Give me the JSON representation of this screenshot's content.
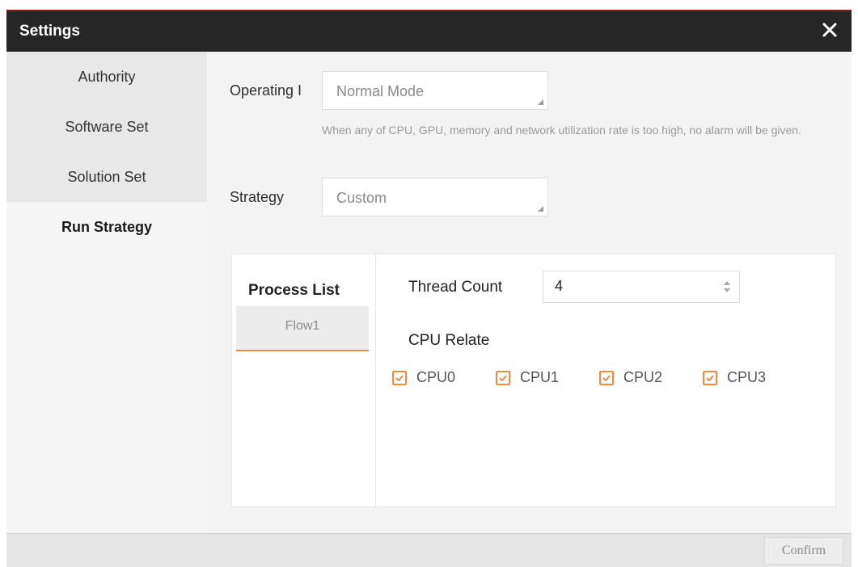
{
  "window": {
    "title": "Settings"
  },
  "sidebar": {
    "items": [
      {
        "label": "Authority"
      },
      {
        "label": "Software Set"
      },
      {
        "label": "Solution Set"
      },
      {
        "label": "Run Strategy"
      }
    ],
    "active": "Run Strategy"
  },
  "form": {
    "operating_label": "Operating I",
    "operating_value": "Normal Mode",
    "hint": "When any of CPU, GPU, memory and network utilization rate is too high, no alarm will be given.",
    "strategy_label": "Strategy",
    "strategy_value": "Custom"
  },
  "process_panel": {
    "title": "Process List",
    "items": [
      {
        "label": "Flow1"
      }
    ],
    "thread_count_label": "Thread Count",
    "thread_count_value": "4",
    "cpu_relate_label": "CPU Relate",
    "cpus": [
      {
        "label": "CPU0",
        "checked": true
      },
      {
        "label": "CPU1",
        "checked": true
      },
      {
        "label": "CPU2",
        "checked": true
      },
      {
        "label": "CPU3",
        "checked": true
      }
    ]
  },
  "footer": {
    "confirm_label": "Confirm"
  },
  "colors": {
    "accent": "#f08a3c",
    "titlebar": "#262626",
    "topline": "#8c1c1c"
  },
  "icons": {
    "close": "close-icon",
    "check": "checkmark-icon",
    "spin": "spin-arrows-icon",
    "grip": "resize-grip-icon"
  }
}
